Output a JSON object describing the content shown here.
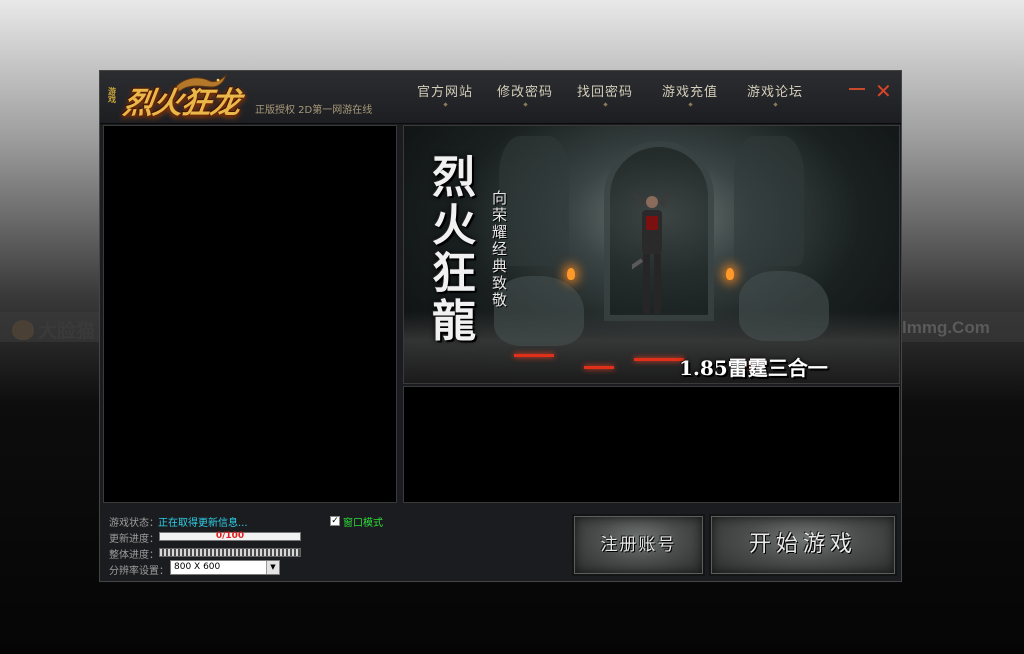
{
  "watermark": {
    "left_text": "大脸猫",
    "right_text": "lmmg.Com"
  },
  "titlebar": {
    "logo_small": "游戏",
    "logo_text": "烈火狂龙",
    "tagline": "正版授权 2D第一网游在线",
    "nav": [
      {
        "label": "官方网站"
      },
      {
        "label": "修改密码"
      },
      {
        "label": "找回密码"
      },
      {
        "label": "游戏充值"
      },
      {
        "label": "游戏论坛"
      }
    ],
    "close_glyph": "✕"
  },
  "banner": {
    "title": "烈火狂龍",
    "subtitle": "向荣耀经典致敬",
    "version": "1.85雷霆三合一"
  },
  "status": {
    "game_status_label": "游戏状态：",
    "game_status_value": "正在取得更新信息...",
    "update_label": "更新进度：",
    "update_text": "0/100",
    "update_progress": 0,
    "total_label": "整体进度：",
    "total_progress": 0,
    "resolution_label": "分辨率设置：",
    "resolution_value": "800 X 600",
    "window_mode_label": "窗口模式",
    "window_mode_checked": true
  },
  "buttons": {
    "register": "注册账号",
    "start": "开始游戏"
  },
  "colors": {
    "status_cyan": "#2fd0e8",
    "window_mode_green": "#2fdc3a",
    "progress_red": "#e02020",
    "close_red": "#d8442a"
  }
}
